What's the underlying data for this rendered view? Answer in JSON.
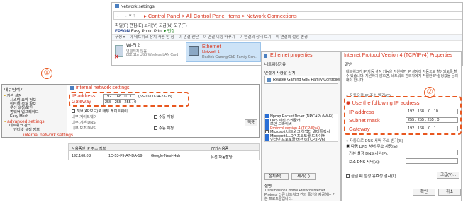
{
  "marker1": "①",
  "marker2": "②",
  "net": {
    "title": "Network settings",
    "breadcrumb": [
      "Control Panel",
      "All Control Panel Items",
      "Network Connections"
    ],
    "menu": [
      "파일(F)",
      "편집(E)",
      "보기(V)",
      "고급(N)",
      "도구(T)"
    ],
    "printer": "Easy Photo Print",
    "printer_brand": "EPSON",
    "printer_extra": "▾  편집",
    "cmdbar": [
      "구성 ▾",
      "이 네트워크 장치 사용 안 함",
      "이 연결 진단",
      "이 연결 이름 바꾸기",
      "이 연결의 상태 보기",
      "이 연결의 설정 변경"
    ],
    "adapters": [
      {
        "name": "Wi-Fi 2",
        "status": "연결되지 않음",
        "device": "802.11n USB Wireless LAN Card"
      },
      {
        "name": "Ethernet",
        "status": "Network 1",
        "device": "Realtek Gaming GbE Family Con..."
      }
    ]
  },
  "eth": {
    "title": "Ethernet properties",
    "tabs": [
      "네트워킹",
      "공유"
    ],
    "connect_label": "연결에 사용할 장치:",
    "device": "Realtek Gaming GbE Family Controller",
    "items": [
      "Npcap Packet Driver (NPCAP) (Wi-Fi)",
      "QoS 패킷 스케줄러",
      "보안 드라이버",
      "Protocol version 4 (TCP/IPv4)",
      "Microsoft 네트워크 어댑터 멀티플렉서",
      "Microsoft LLDP 프로토콜 드라이버",
      "인터넷 프로토콜 버전 6(TCP/IPv6)"
    ],
    "install": "설치(N)...",
    "remove": "제거(U)",
    "desc_title": "설명",
    "desc": "Transmission Control Protocol/Internet Protocol 다른 네트워크 간의 통신을 제공하는 기본 프로토콜입니다."
  },
  "ipv4": {
    "title": "Internet Protocol Version 4 (TCP/IPv4) Properties",
    "tab": "일반",
    "desc": "네트워크가 IP 자동 설정 기능을 지원하면 IP 설정이 자동으로 할당되도록 할 수 있습니다. 지원하지 않으면, 네트워크 관리자에게 적절한 IP 설정값을 문의해야 합니다.",
    "auto_ip": "자동으로 IP 주소 받기(O)",
    "use_ip": "Use the following IP address",
    "ip_label": "IP address",
    "ip": [
      "192",
      ".",
      "168",
      ".",
      "0",
      ".",
      "10"
    ],
    "mask_label": "Subnet mask",
    "mask": [
      "255",
      ".",
      "255",
      ".",
      "255",
      ".",
      "0"
    ],
    "gw_label": "Gateway",
    "gw": [
      "192",
      ".",
      "168",
      ".",
      "0",
      ".",
      "1"
    ],
    "auto_dns": "자동으로 DNS 서버 주소 받기(B)",
    "use_dns": "다음 DNS 서버 주소 사용(E):",
    "dns1": "기본 설정 DNS 서버(P):",
    "dns2": "보조 DNS 서버(A):",
    "validate": "끝낼 때 설정 유효성 검사(L)",
    "advanced": "고급(V)...",
    "ok": "확인",
    "cancel": "취소"
  },
  "router": {
    "title": "메뉴탐색기",
    "tree": [
      "기본 설정",
      "시스템 요약 정보",
      "인터넷 설정 정보",
      "무선 설정/보안",
      "펌웨어 업그레이드",
      "Easy Mesh"
    ],
    "adv": "advanced settings",
    "adv_items": [
      "네트워크 관리",
      "인터넷 설정 정보"
    ],
    "internal": "internal network settings",
    "panel_title": "internal network settings",
    "ip_label": "IP address",
    "ip": "192 . 168 . 0 . 1",
    "mac": "(55-00-00-34-23-03)",
    "gw_label": "Gateway",
    "gw": "255 . 255 . 255 . 0",
    "dhcp_opt": "허브(AP모드)로 내부 게이트웨이",
    "rows": [
      "내부 게이트웨이",
      "내부 기본 DNS",
      "내부 보조 DNS"
    ],
    "manual": "수동 지정",
    "apply": "적용",
    "table_headers": [
      "사용중인 IP 주소 정보",
      "",
      "",
      "77가시용중"
    ],
    "row": [
      "192.168.0.2",
      "1C-53-F9-A7-DA-19",
      "Google-Nest-Hub",
      "유선 자동할당"
    ]
  }
}
